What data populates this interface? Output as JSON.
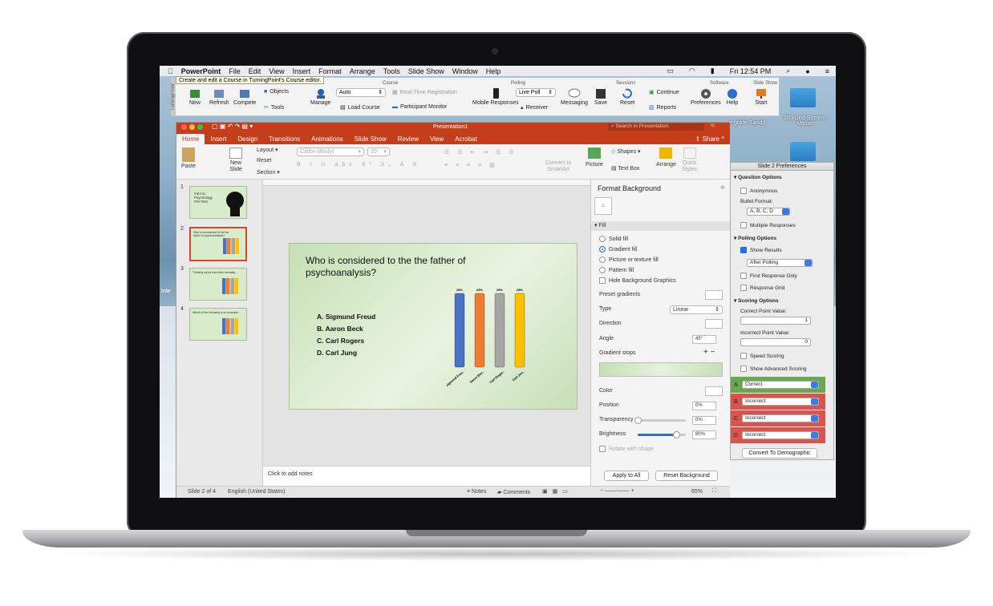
{
  "menubar": {
    "apple": "",
    "app": "PowerPoint",
    "items": [
      "File",
      "Edit",
      "View",
      "Insert",
      "Format",
      "Arrange",
      "Tools",
      "Slide Show",
      "Window",
      "Help"
    ],
    "clock": "Fri 12:54 PM"
  },
  "tooltip": "Create and edit a Course in TurningPoint's Course editor.",
  "turningpoint": {
    "side_label": "TurningPoint",
    "groups": {
      "course": "Course",
      "polling": "Polling",
      "sessions": "Sessions",
      "software": "Software",
      "slideshow": "Slide Show"
    },
    "buttons": {
      "new": "New",
      "refresh": "Refresh",
      "compete": "Compete",
      "objects": "Objects",
      "tools": "Tools",
      "manage": "Manage",
      "auto": "Auto",
      "load_course": "Load Course",
      "realtime": "Real-Time Registration",
      "participant_monitor": "Participant Monitor",
      "mobile": "Mobile Responses",
      "live_poll": "Live Poll",
      "receiver": "Receiver",
      "messaging": "Messaging",
      "save": "Save",
      "reset": "Reset",
      "continue": "Continue",
      "reports": "Reports",
      "preferences": "Preferences",
      "help": "Help",
      "start": "Start"
    }
  },
  "window": {
    "title": "Presentation1",
    "search_placeholder": "Search in Presentation",
    "share": "Share"
  },
  "tabs": [
    "Home",
    "Insert",
    "Design",
    "Transitions",
    "Animations",
    "Slide Show",
    "Review",
    "View",
    "Acrobat"
  ],
  "ribbon": {
    "paste": "Paste",
    "new_slide": "New\nSlide",
    "layout": "Layout",
    "reset": "Reset",
    "section": "Section",
    "font": "Calibri (Body)",
    "size": "20",
    "convert": "Convert to\nSmartArt",
    "picture": "Picture",
    "shapes": "Shapes",
    "text_box": "Text Box",
    "arrange": "Arrange",
    "quick_styles": "Quick\nStyles"
  },
  "thumbs": [
    {
      "num": "1",
      "title": "Intro to Psychology Pre-Test"
    },
    {
      "num": "2",
      "title": "Who is considered to the the father of psychoanalysis?"
    },
    {
      "num": "3",
      "title": "Thinking about each item mentally..."
    },
    {
      "num": "4",
      "title": "Which of the following is an example..."
    }
  ],
  "slide": {
    "question": "Who is considered to the the father of psychoanalysis?",
    "answers": [
      "A.  Sigmund Freud",
      "B.  Aaron Beck",
      "C.  Carl Rogers",
      "D.  Carl Jung"
    ]
  },
  "chart_data": {
    "type": "bar",
    "categories": [
      "Sigmund Freud",
      "Aaron Beck",
      "Carl Rogers",
      "Carl Jung"
    ],
    "category_labels": [
      "Sigmund Freu..",
      "Aaron Bec..",
      "Carl Roger..",
      "Carl Jun.."
    ],
    "values": [
      25,
      25,
      25,
      25
    ],
    "value_labels": [
      "25%",
      "25%",
      "25%",
      "25%"
    ],
    "colors": [
      "#4a72c4",
      "#ed7d31",
      "#a5a5a5",
      "#ffc000"
    ]
  },
  "notes": "Click to add notes",
  "status": {
    "slide": "Slide 2 of 4",
    "lang": "English (United States)",
    "notes": "Notes",
    "comments": "Comments",
    "zoom": "65%"
  },
  "format": {
    "title": "Format Background",
    "fill": "Fill",
    "options": [
      "Solid fill",
      "Gradient fill",
      "Picture or texture fill",
      "Pattern fill"
    ],
    "hide_bg": "Hide Background Graphics",
    "preset": "Preset gradients",
    "type": "Type",
    "type_val": "Linear",
    "direction": "Direction",
    "angle": "Angle",
    "angle_val": "45°",
    "stops": "Gradient stops",
    "color": "Color",
    "position": "Position",
    "position_val": "0%",
    "transparency": "Transparency",
    "transparency_val": "0%",
    "brightness": "Brightness",
    "brightness_val": "80%",
    "rotate": "Rotate with shape",
    "apply_all": "Apply to All",
    "reset_bg": "Reset Background"
  },
  "prefs": {
    "title": "Slide 2 Preferences",
    "question_options": "Question Options",
    "anonymous": "Anonymous",
    "bullet_format": "Bullet Format:",
    "bullet_val": "A, B, C, D",
    "multiple": "Multiple Responses",
    "polling_options": "Polling Options",
    "show_results": "Show Results",
    "after_polling": "After Polling",
    "first_response": "First Response Only",
    "response_grid": "Response Grid",
    "scoring_options": "Scoring Options",
    "correct_value": "Correct Point Value:",
    "correct_val": "1",
    "incorrect_value": "Incorrect Point Value:",
    "incorrect_val": "0",
    "speed": "Speed Scoring",
    "advanced": "Show Advanced Scoring",
    "answers": [
      {
        "letter": "A",
        "value": "Correct",
        "color": "#6aa84f"
      },
      {
        "letter": "B",
        "value": "Incorrect",
        "color": "#d9534f"
      },
      {
        "letter": "C",
        "value": "Incorrect",
        "color": "#d9534f"
      },
      {
        "letter": "D",
        "value": "Incorrect",
        "color": "#d9534f"
      }
    ],
    "convert": "Convert To Demographic"
  },
  "desktop": {
    "label1": "360-Grid-System-Master",
    "label2": "e guide Sandd",
    "label3": "Inte"
  }
}
